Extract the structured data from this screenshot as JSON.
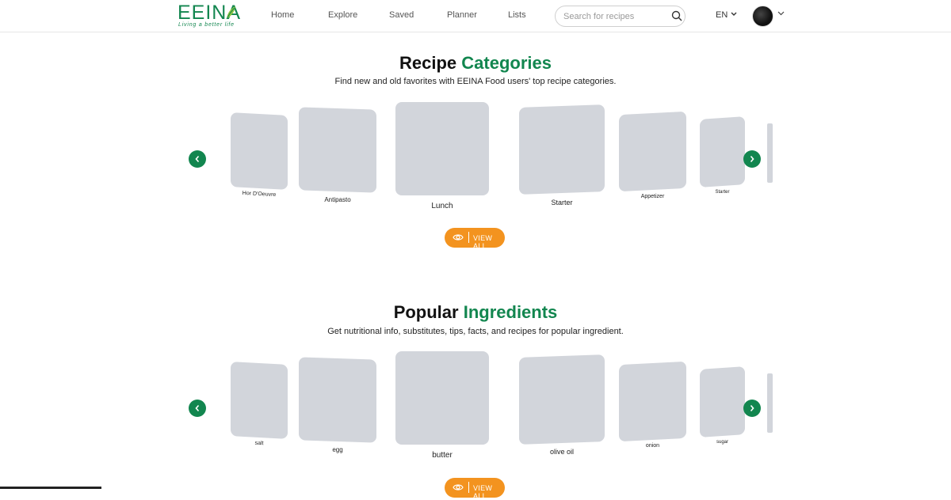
{
  "header": {
    "logo_text": "EEINA",
    "logo_tagline": "Living a better life",
    "nav": [
      "Home",
      "Explore",
      "Saved",
      "Planner",
      "Lists"
    ],
    "search_placeholder": "Search for recipes",
    "language": "EN",
    "brand_color": "#12864f"
  },
  "categories": {
    "title_plain": "Recipe",
    "title_accent": "Categories",
    "subtitle": "Find new and old favorites with EEINA Food users' top recipe categories.",
    "items": [
      "Hor D'Oeuvre",
      "Antipasto",
      "Lunch",
      "Starter",
      "Appetizer",
      "Starter"
    ],
    "view_all": "VIEW ALL"
  },
  "ingredients": {
    "title_plain": "Popular",
    "title_accent": "Ingredients",
    "subtitle": "Get nutritional info, substitutes, tips, facts, and recipes for popular ingredient.",
    "items": [
      "salt",
      "egg",
      "butter",
      "olive oil",
      "onion",
      "sugar"
    ],
    "view_all": "VIEW ALL"
  },
  "colors": {
    "accent": "#12864f",
    "button": "#f3931f",
    "placeholder_card": "#d2d5db"
  }
}
